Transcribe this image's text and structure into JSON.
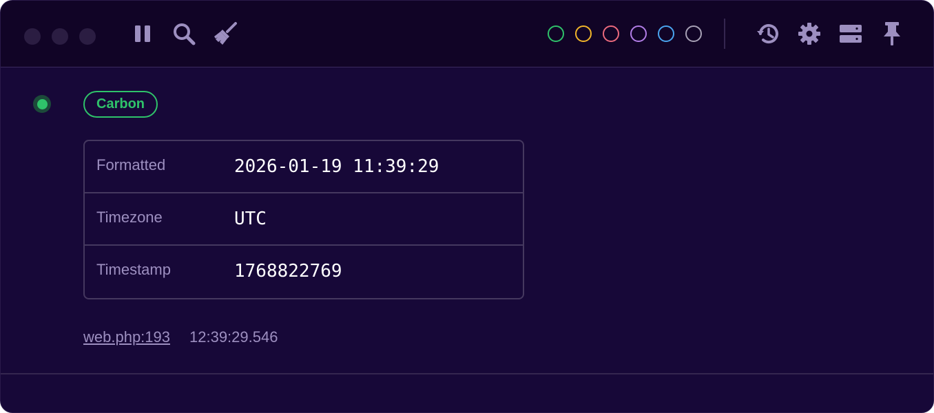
{
  "toolbar": {
    "filters": [
      {
        "name": "green",
        "color": "#2fc36a"
      },
      {
        "name": "yellow",
        "color": "#f2b62a"
      },
      {
        "name": "red",
        "color": "#ec6a7d"
      },
      {
        "name": "purple",
        "color": "#b37ee8"
      },
      {
        "name": "blue",
        "color": "#4aa5ef"
      },
      {
        "name": "gray",
        "color": "#a8a2b6"
      }
    ],
    "icon_color": "#9d8fc0"
  },
  "entry": {
    "status_color": "#2fc36a",
    "badge": {
      "label": "Carbon",
      "color": "#2fc36a"
    },
    "rows": [
      {
        "key": "Formatted",
        "value": "2026-01-19 11:39:29"
      },
      {
        "key": "Timezone",
        "value": "UTC"
      },
      {
        "key": "Timestamp",
        "value": "1768822769"
      }
    ],
    "file": "web.php:193",
    "time": "12:39:29.546"
  }
}
